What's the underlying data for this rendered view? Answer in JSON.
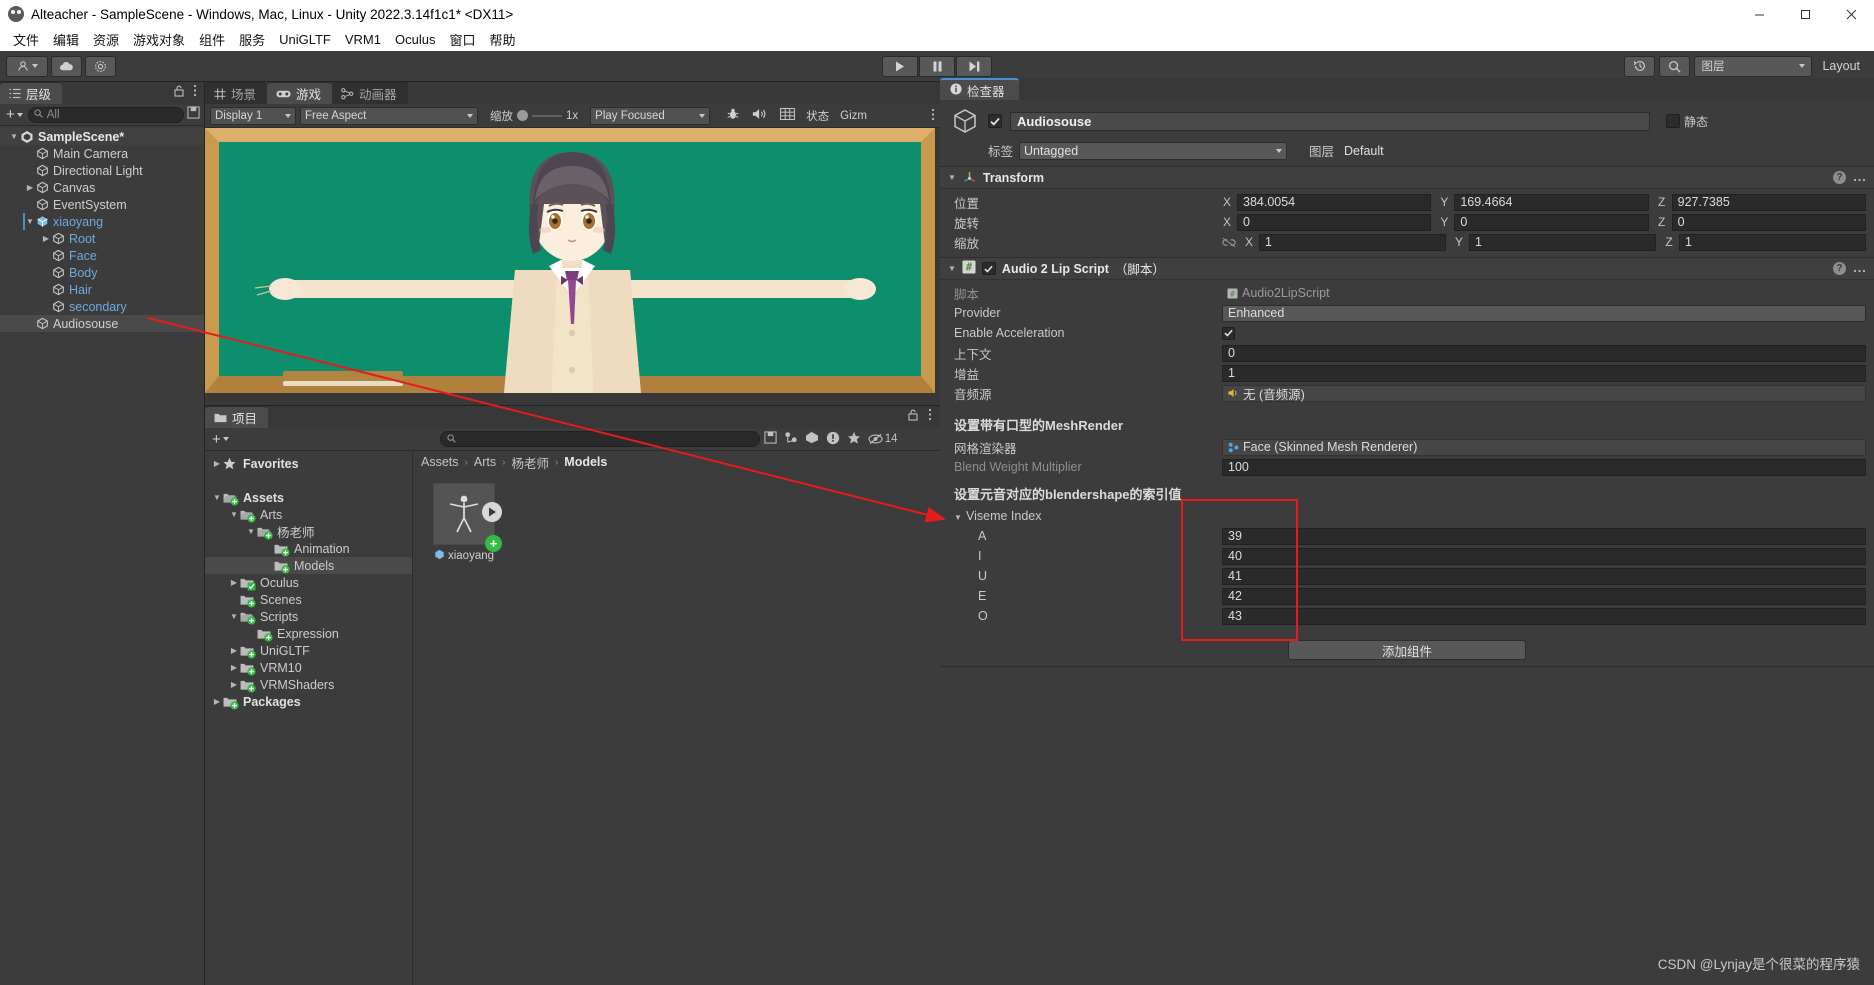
{
  "window": {
    "title": "Alteacher - SampleScene - Windows, Mac, Linux - Unity 2022.3.14f1c1* <DX11>",
    "minimize": "—",
    "maximize": "❐",
    "close": "✕"
  },
  "menubar": {
    "items": [
      "文件",
      "编辑",
      "资源",
      "游戏对象",
      "组件",
      "服务",
      "UniGLTF",
      "VRM1",
      "Oculus",
      "窗口",
      "帮助"
    ]
  },
  "toolbar": {
    "account_icon": "account-icon",
    "cloud_icon": "cloud-icon",
    "settings_icon": "gear-icon",
    "play_icon": "play-icon",
    "pause_icon": "pause-icon",
    "step_icon": "step-icon",
    "history_icon": "history-icon",
    "search_icon": "search-icon",
    "layers_label": "图层",
    "layout_label": "Layout"
  },
  "hierarchy": {
    "tab_label": "层级",
    "tab_icon": "hierarchy-icon",
    "search_placeholder": "All",
    "add_label": "+",
    "items": [
      {
        "label": "SampleScene*",
        "depth": 0,
        "icon": "unity-scene-icon",
        "expanded": true,
        "selected": false,
        "root": true
      },
      {
        "label": "Main Camera",
        "depth": 1,
        "icon": "gameobject-icon",
        "expanded": null,
        "selected": false
      },
      {
        "label": "Directional Light",
        "depth": 1,
        "icon": "gameobject-icon",
        "expanded": null,
        "selected": false
      },
      {
        "label": "Canvas",
        "depth": 1,
        "icon": "gameobject-icon",
        "expanded": false,
        "selected": false
      },
      {
        "label": "EventSystem",
        "depth": 1,
        "icon": "gameobject-icon",
        "expanded": null,
        "selected": false
      },
      {
        "label": "xiaoyang",
        "depth": 1,
        "icon": "prefab-icon",
        "expanded": true,
        "selected": false,
        "prefab": true
      },
      {
        "label": "Root",
        "depth": 2,
        "icon": "gameobject-icon",
        "expanded": false,
        "selected": false,
        "prefab": true
      },
      {
        "label": "Face",
        "depth": 2,
        "icon": "gameobject-icon",
        "expanded": null,
        "selected": false,
        "prefab": true
      },
      {
        "label": "Body",
        "depth": 2,
        "icon": "gameobject-icon",
        "expanded": null,
        "selected": false,
        "prefab": true
      },
      {
        "label": "Hair",
        "depth": 2,
        "icon": "gameobject-icon",
        "expanded": null,
        "selected": false,
        "prefab": true
      },
      {
        "label": "secondary",
        "depth": 2,
        "icon": "gameobject-icon",
        "expanded": null,
        "selected": false,
        "prefab": true
      },
      {
        "label": "Audiosouse",
        "depth": 1,
        "icon": "gameobject-icon",
        "expanded": null,
        "selected": true
      }
    ]
  },
  "gameview": {
    "tabs": [
      {
        "label": "场景",
        "icon": "scene-icon",
        "active": false
      },
      {
        "label": "游戏",
        "icon": "gamepad-icon",
        "active": true
      },
      {
        "label": "动画器",
        "icon": "animator-icon",
        "active": false
      }
    ],
    "display": "Display 1",
    "aspect": "Free Aspect",
    "zoom_label": "缩放",
    "zoom_value": "1x",
    "play_mode": "Play Focused",
    "stats_label": "状态",
    "gizmos_label": "Gizm",
    "mute_icon": "mute-audio-icon",
    "bug_icon": "bug-icon",
    "grid_icon": "grid-icon"
  },
  "project": {
    "tab_label": "项目",
    "tab_icon": "folder-icon",
    "add_label": "+",
    "search_placeholder": "",
    "hidden_count": "14",
    "tree": [
      {
        "label": "Favorites",
        "depth": 0,
        "icon": "star-icon",
        "expanded": false,
        "bold": true,
        "selected": false
      },
      {
        "label": "",
        "depth": 0,
        "icon": "spacer",
        "spacer": true
      },
      {
        "label": "Assets",
        "depth": 0,
        "icon": "folder-open-icon",
        "expanded": true,
        "bold": true,
        "selected": false
      },
      {
        "label": "Arts",
        "depth": 1,
        "icon": "folder-open-icon",
        "expanded": true,
        "selected": false
      },
      {
        "label": "杨老师",
        "depth": 2,
        "icon": "folder-open-icon",
        "expanded": true,
        "selected": false
      },
      {
        "label": "Animation",
        "depth": 3,
        "icon": "folder-icon",
        "expanded": null,
        "selected": false
      },
      {
        "label": "Models",
        "depth": 3,
        "icon": "folder-icon",
        "expanded": null,
        "selected": true
      },
      {
        "label": "Oculus",
        "depth": 1,
        "icon": "folder-pkg-icon",
        "expanded": false,
        "selected": false
      },
      {
        "label": "Scenes",
        "depth": 1,
        "icon": "folder-icon",
        "expanded": null,
        "selected": false
      },
      {
        "label": "Scripts",
        "depth": 1,
        "icon": "folder-open-icon",
        "expanded": true,
        "selected": false
      },
      {
        "label": "Expression",
        "depth": 2,
        "icon": "folder-icon",
        "expanded": null,
        "selected": false
      },
      {
        "label": "UniGLTF",
        "depth": 1,
        "icon": "folder-icon",
        "expanded": false,
        "selected": false
      },
      {
        "label": "VRM10",
        "depth": 1,
        "icon": "folder-icon",
        "expanded": false,
        "selected": false
      },
      {
        "label": "VRMShaders",
        "depth": 1,
        "icon": "folder-icon",
        "expanded": false,
        "selected": false
      },
      {
        "label": "Packages",
        "depth": 0,
        "icon": "folder-icon",
        "expanded": false,
        "bold": true,
        "selected": false
      }
    ],
    "breadcrumb": [
      "Assets",
      "Arts",
      "杨老师",
      "Models"
    ],
    "assets": [
      {
        "name": "xiaoyang",
        "icon": "model-prefab-icon"
      }
    ]
  },
  "inspector": {
    "tab_label": "检查器",
    "tab_icon": "info-icon",
    "object_name": "Audiosouse",
    "enabled": true,
    "static_label": "静态",
    "tag_label": "标签",
    "tag_value": "Untagged",
    "layer_label": "图层",
    "layer_value": "Default",
    "transform": {
      "title": "Transform",
      "icon": "transform-icon",
      "rows": [
        {
          "label": "位置",
          "x": "384.0054",
          "y": "169.4664",
          "z": "927.7385",
          "link": false
        },
        {
          "label": "旋转",
          "x": "0",
          "y": "0",
          "z": "0",
          "link": false
        },
        {
          "label": "缩放",
          "x": "1",
          "y": "1",
          "z": "1",
          "link": true
        }
      ],
      "axis_labels": [
        "X",
        "Y",
        "Z"
      ]
    },
    "script_component": {
      "title": "Audio 2 Lip Script",
      "title_suffix": "（脚本）",
      "icon": "script-icon",
      "enabled": true,
      "fields": [
        {
          "label": "脚本",
          "value": "Audio2LipScript",
          "type": "object",
          "dim": true,
          "icon": "script-asset-icon"
        },
        {
          "label": "Provider",
          "value": "Enhanced",
          "type": "dropdown"
        },
        {
          "label": "Enable Acceleration",
          "value": "",
          "type": "checkbox",
          "checked": true
        },
        {
          "label": "上下文",
          "value": "0",
          "type": "number"
        },
        {
          "label": "增益",
          "value": "1",
          "type": "number"
        },
        {
          "label": "音频源",
          "value": "无 (音频源)",
          "type": "object",
          "icon": "audio-icon"
        }
      ],
      "note1": "设置带有口型的MeshRender",
      "mesh_fields": [
        {
          "label": "网格渲染器",
          "value": "Face (Skinned Mesh Renderer)",
          "type": "object",
          "icon": "mesh-renderer-icon"
        },
        {
          "label": "Blend Weight Multiplier",
          "value": "100",
          "type": "number",
          "dim": true
        }
      ],
      "note2": "设置元音对应的blendershape的索引值",
      "viseme_label": "Viseme Index",
      "viseme_rows": [
        {
          "label": "A",
          "value": "39"
        },
        {
          "label": "I",
          "value": "40"
        },
        {
          "label": "U",
          "value": "41"
        },
        {
          "label": "E",
          "value": "42"
        },
        {
          "label": "O",
          "value": "43"
        }
      ]
    },
    "add_component_label": "添加组件"
  },
  "watermark": "CSDN @Lynjay是个很菜的程序猿",
  "colors": {
    "accent_blue": "#4a8fd4",
    "annotation_red": "#e81b1b",
    "panel_bg": "#3c3c3c",
    "dark_bg": "#2a2a2a",
    "prefab_blue": "#6fa8e0",
    "green_badge": "#33bb44",
    "board_green": "#0d8f6e",
    "board_frame": "#c99a4e"
  }
}
